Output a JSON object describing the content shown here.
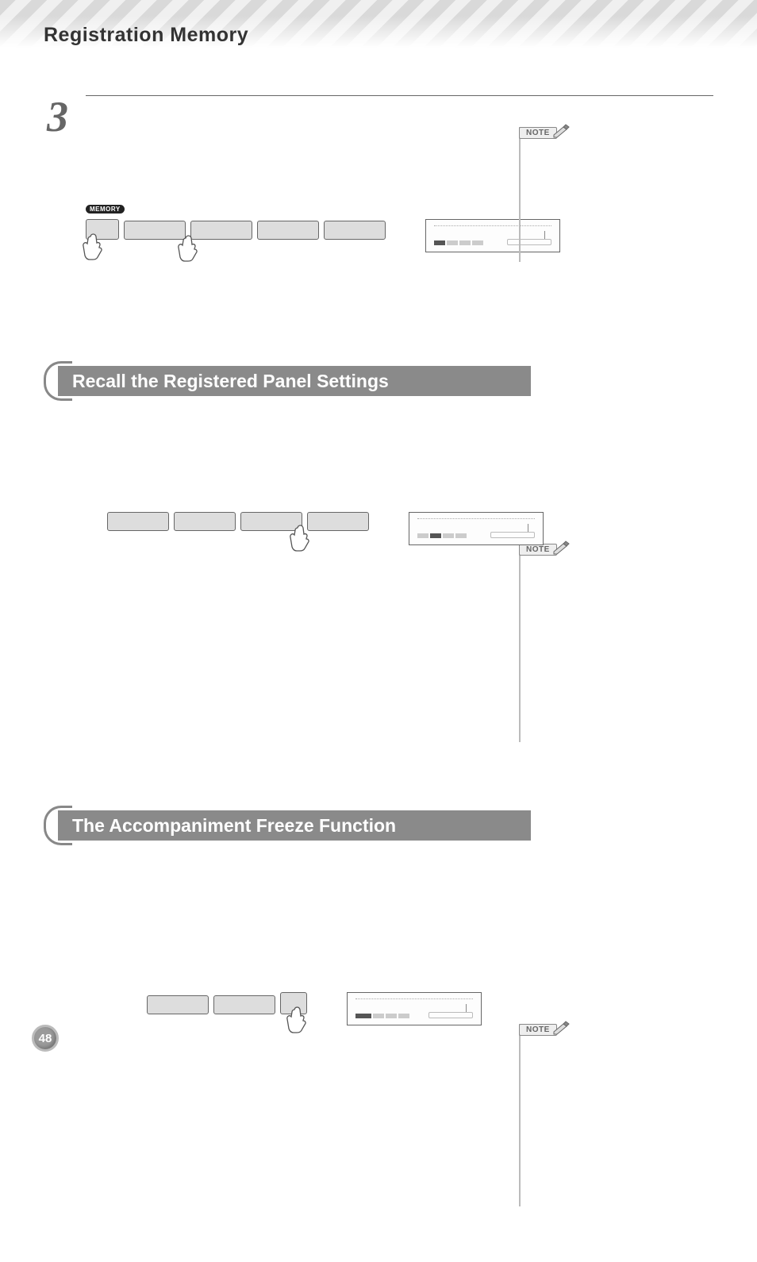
{
  "header": {
    "title": "Registration Memory"
  },
  "step3": {
    "number": "3",
    "note_label": "NOTE",
    "memory_label": "MEMORY"
  },
  "section_recall": {
    "title": "Recall the Registered Panel Settings",
    "note_label": "NOTE"
  },
  "section_freeze": {
    "title": "The Accompaniment Freeze Function",
    "note_label": "NOTE"
  },
  "page_number": "48"
}
